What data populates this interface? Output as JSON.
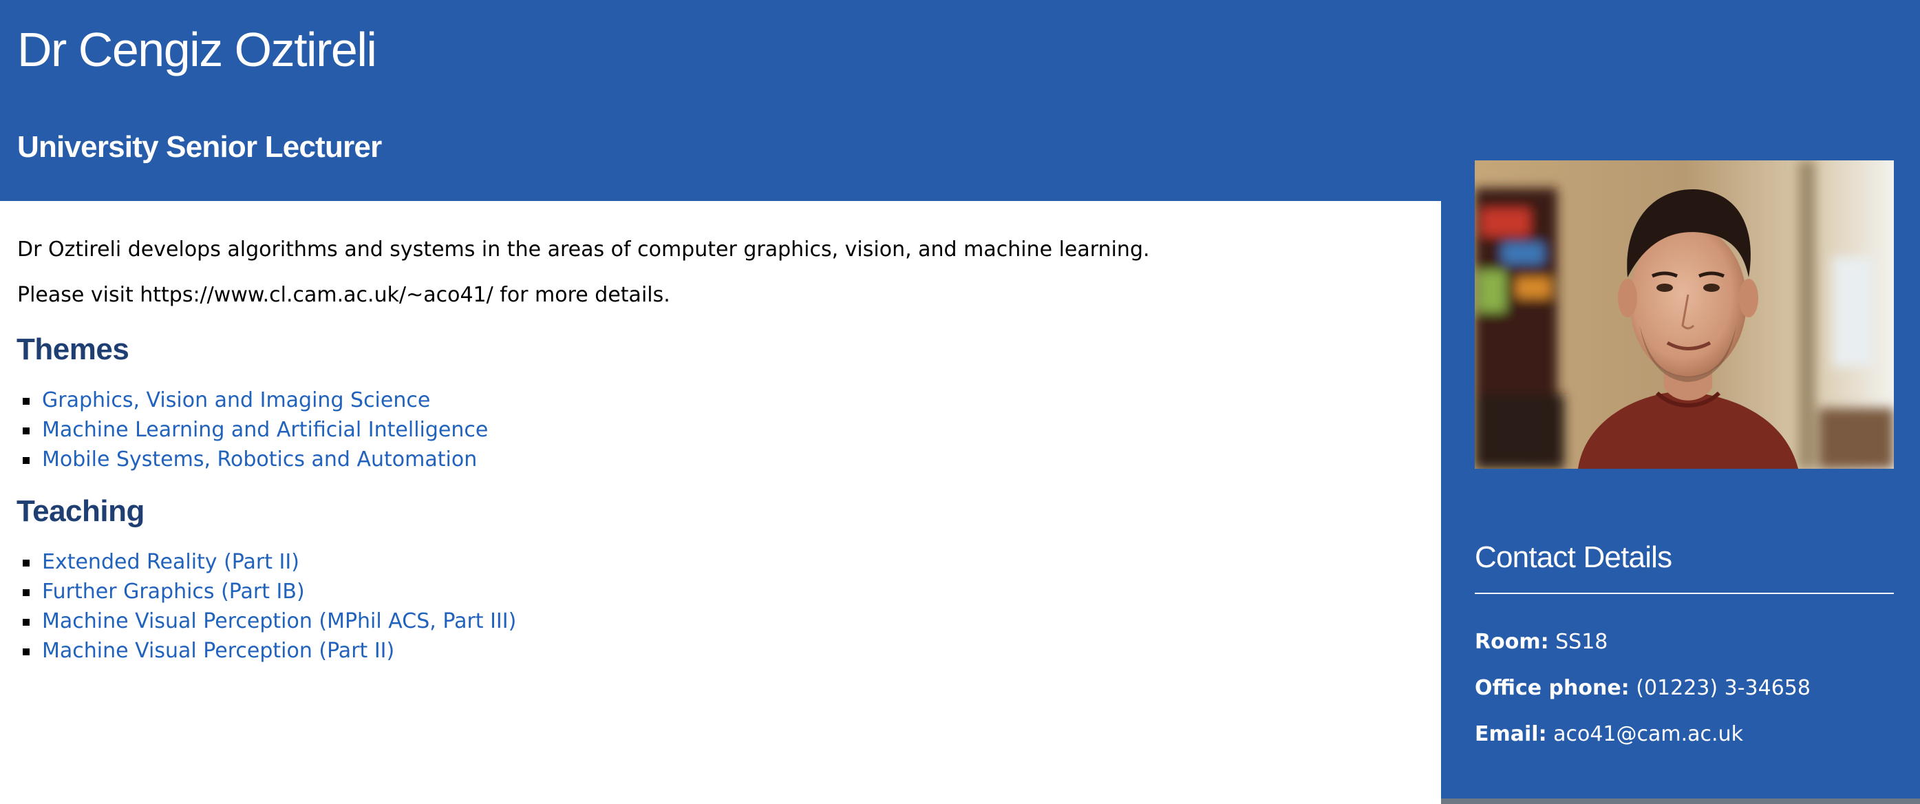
{
  "header": {
    "name": "Dr Cengiz Oztireli",
    "role": "University Senior Lecturer"
  },
  "intro": {
    "summary": "Dr Oztireli develops algorithms and systems in the areas of computer graphics, vision, and machine learning.",
    "visit": "Please visit https://www.cl.cam.ac.uk/~aco41/ for more details."
  },
  "themes": {
    "heading": "Themes",
    "items": [
      {
        "label": "Graphics, Vision and Imaging Science"
      },
      {
        "label": "Machine Learning and Artificial Intelligence"
      },
      {
        "label": "Mobile Systems, Robotics and Automation"
      }
    ]
  },
  "teaching": {
    "heading": "Teaching",
    "items": [
      {
        "label": "Extended Reality (Part II)"
      },
      {
        "label": "Further Graphics (Part IB)"
      },
      {
        "label": "Machine Visual Perception (MPhil ACS, Part III)"
      },
      {
        "label": "Machine Visual Perception (Part II)"
      }
    ]
  },
  "contact": {
    "title": "Contact Details",
    "room": {
      "label": "Room:",
      "value": "SS18"
    },
    "phone": {
      "label": "Office phone:",
      "value": "(01223) 3-34658"
    },
    "email": {
      "label": "Email:",
      "value": "aco41@cam.ac.uk"
    }
  },
  "colors": {
    "brand_blue": "#265ca9",
    "heading_blue": "#1f3f73",
    "link_blue": "#2162bd"
  }
}
